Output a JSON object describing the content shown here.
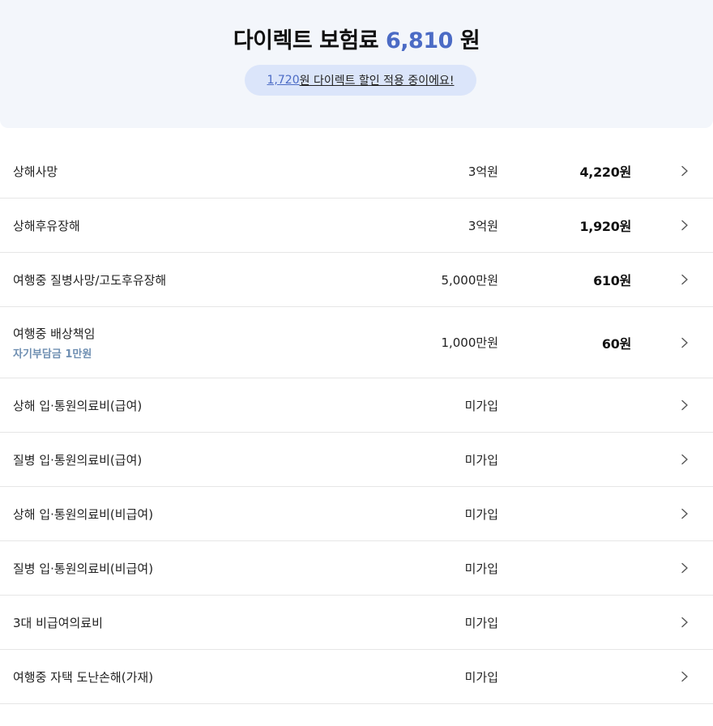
{
  "header": {
    "title_prefix": "다이렉트 보험료 ",
    "amount": "6,810",
    "title_suffix": " 원",
    "discount_amount": "1,720",
    "discount_text": "원 다이렉트 할인 적용 중이에요!"
  },
  "rows": [
    {
      "name": "상해사망",
      "sub": "",
      "coverage": "3억원",
      "premium": "4,220원"
    },
    {
      "name": "상해후유장해",
      "sub": "",
      "coverage": "3억원",
      "premium": "1,920원"
    },
    {
      "name": "여행중 질병사망/고도후유장해",
      "sub": "",
      "coverage": "5,000만원",
      "premium": "610원"
    },
    {
      "name": "여행중 배상책임",
      "sub": "자기부담금 1만원",
      "coverage": "1,000만원",
      "premium": "60원"
    },
    {
      "name": "상해 입·통원의료비(급여)",
      "sub": "",
      "coverage": "미가입",
      "premium": ""
    },
    {
      "name": "질병 입·통원의료비(급여)",
      "sub": "",
      "coverage": "미가입",
      "premium": ""
    },
    {
      "name": "상해 입·통원의료비(비급여)",
      "sub": "",
      "coverage": "미가입",
      "premium": ""
    },
    {
      "name": "질병 입·통원의료비(비급여)",
      "sub": "",
      "coverage": "미가입",
      "premium": ""
    },
    {
      "name": "3대 비급여의료비",
      "sub": "",
      "coverage": "미가입",
      "premium": ""
    },
    {
      "name": "여행중 자택 도난손해(가재)",
      "sub": "",
      "coverage": "미가입",
      "premium": ""
    }
  ],
  "icons": {
    "row_chevron": "chevron-right-icon"
  },
  "colors": {
    "accent": "#4b6bc5",
    "header_bg": "#f3f6fb",
    "pill_bg": "#dbe5fa",
    "sub_text": "#6f8fb2"
  }
}
